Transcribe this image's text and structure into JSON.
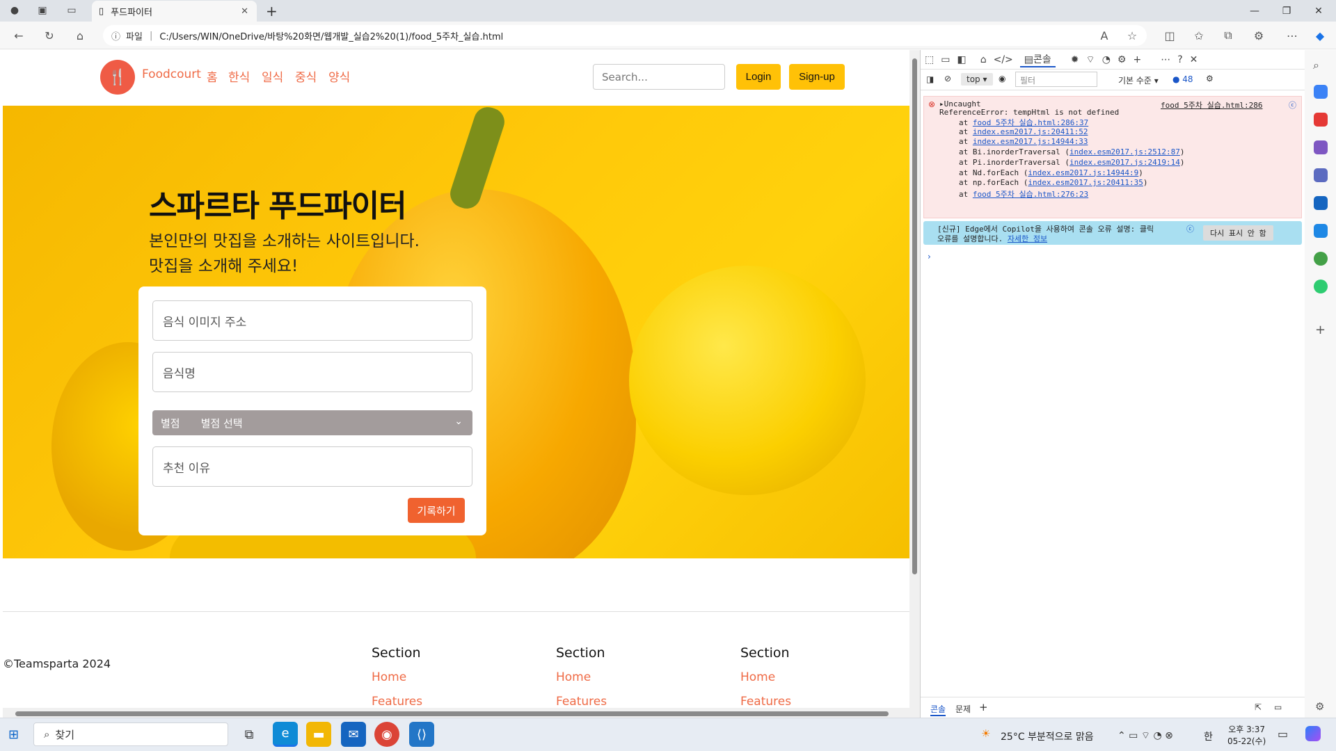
{
  "browser": {
    "tab_title": "푸드파이터",
    "address_prefix": "파일",
    "url": "C:/Users/WIN/OneDrive/바탕%20화면/웹개발_실습2%20(1)/food_5주차_실습.html"
  },
  "site": {
    "brand": "Foodcourt",
    "nav": [
      "홈",
      "한식",
      "일식",
      "중식",
      "양식"
    ],
    "search_placeholder": "Search...",
    "login": "Login",
    "signup": "Sign-up"
  },
  "hero": {
    "title": "스파르타 푸드파이터",
    "subtitle_line1": "본인만의 맛집을 소개하는 사이트입니다.",
    "subtitle_line2": "맛집을 소개해 주세요!"
  },
  "form": {
    "image_placeholder": "음식 이미지 주소",
    "name_placeholder": "음식명",
    "rating_label": "별점",
    "rating_value": "별점 선택",
    "reason_placeholder": "추천 이유",
    "submit": "기록하기"
  },
  "footer": {
    "copyright": "©Teamsparta 2024",
    "columns": [
      {
        "heading": "Section",
        "links": [
          "Home",
          "Features"
        ]
      },
      {
        "heading": "Section",
        "links": [
          "Home",
          "Features"
        ]
      },
      {
        "heading": "Section",
        "links": [
          "Home",
          "Features"
        ]
      }
    ]
  },
  "devtools": {
    "active_tab": "콘솔",
    "context": "top",
    "filter_placeholder": "필터",
    "level": "기본 수준",
    "issue_count": "48",
    "error": {
      "head": "Uncaught",
      "message": "ReferenceError: tempHtml is not defined",
      "source": "food 5주차 실습.html:286",
      "stack": [
        {
          "prefix": "at ",
          "link": "food 5주차 실습.html:286:37",
          "suffix": ""
        },
        {
          "prefix": "at ",
          "link": "index.esm2017.js:20411:52",
          "suffix": ""
        },
        {
          "prefix": "at ",
          "link": "index.esm2017.js:14944:33",
          "suffix": ""
        },
        {
          "prefix": "at Bi.inorderTraversal (",
          "link": "index.esm2017.js:2512:87",
          "suffix": ")"
        },
        {
          "prefix": "at Pi.inorderTraversal (",
          "link": "index.esm2017.js:2419:14",
          "suffix": ")"
        },
        {
          "prefix": "at Nd.forEach (",
          "link": "index.esm2017.js:14944:9",
          "suffix": ")"
        },
        {
          "prefix": "at np.forEach (",
          "link": "index.esm2017.js:20411:35",
          "suffix": ")"
        },
        {
          "prefix": "at ",
          "link": "food 5주차 실습.html:276:23",
          "suffix": ""
        }
      ]
    },
    "copilot_line1": "[신규] Edge에서 Copilot을 사용하여 콘솔 오류 설명: 클릭",
    "copilot_line2": "오류를 설명합니다.",
    "copilot_link": "자세한 정보",
    "copilot_dismiss": "다시 표시 안 함",
    "bottom_tabs": [
      "콘솔",
      "문제"
    ]
  },
  "taskbar": {
    "search": "찾기",
    "weather": "25°C  부분적으로 맑음",
    "ime": "한",
    "time": "오후 3:37",
    "date": "05-22(수)"
  },
  "colors": {
    "accent_orange": "#ef6a45",
    "button_yellow": "#ffc107",
    "submit_orange": "#f0622f",
    "hero_yellow": "#ffc90a"
  }
}
